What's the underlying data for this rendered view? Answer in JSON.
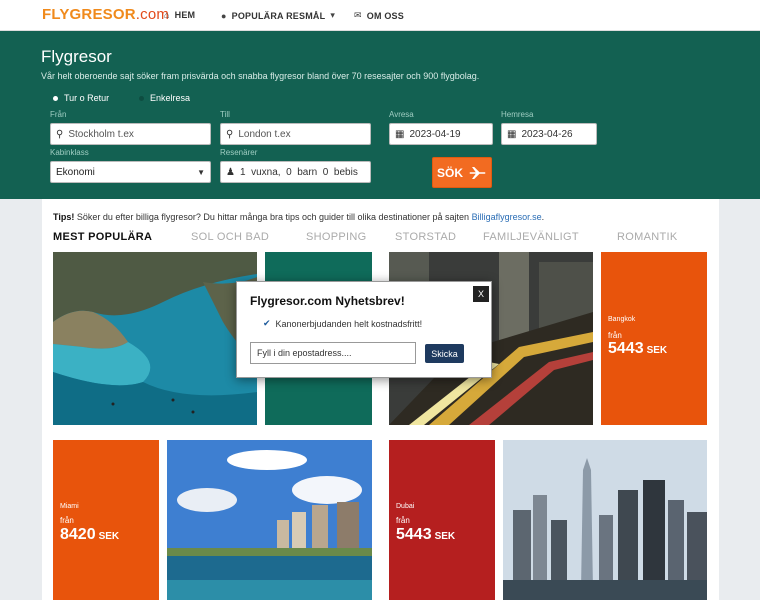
{
  "nav": {
    "logo_main": "FLYGRESOR",
    "logo_tld": ".com",
    "items": [
      {
        "label": "HEM",
        "icon": "home-icon"
      },
      {
        "label": "POPULÄRA RESMÅL",
        "icon": "map-marker-icon",
        "dropdown": "chevron-down-icon"
      },
      {
        "label": "OM OSS",
        "icon": "envelope-icon"
      }
    ]
  },
  "hero": {
    "title": "Flygresor",
    "subtitle": "Vår helt oberoende sajt söker fram prisvärda och snabba flygresor bland över 70 resesajter och 900 flygbolag.",
    "trip_types": [
      "Tur o Retur",
      "Enkelresa"
    ],
    "from": {
      "label": "Från",
      "placeholder": "Stockholm t.ex"
    },
    "to": {
      "label": "Till",
      "placeholder": "London t.ex"
    },
    "depart": {
      "label": "Avresa",
      "value": "2023-04-19"
    },
    "return": {
      "label": "Hemresa",
      "value": "2023-04-26"
    },
    "cabin": {
      "label": "Kabinklass",
      "value": "Ekonomi"
    },
    "travellers": {
      "label": "Resenärer",
      "value": "1  vuxna,  0  barn  0  bebis"
    },
    "search_label": "SÖK"
  },
  "tips": {
    "bold": "Tips!",
    "text": " Söker du efter billiga flygresor? Du hittar många bra tips och guider till olika destinationer på sajten ",
    "link": "Billigaflygresor.se",
    "tail": "."
  },
  "tabs": [
    "MEST POPULÄRA",
    "SOL OCH BAD",
    "SHOPPING",
    "STORSTAD",
    "FAMILJEVÄNLIGT",
    "ROMANTIK"
  ],
  "deals": [
    {
      "city": "Bangkok",
      "from_label": "från",
      "price": "5443",
      "currency": "SEK"
    },
    {
      "city": "Miami",
      "from_label": "från",
      "price": "8420",
      "currency": "SEK"
    },
    {
      "city": "Dubai",
      "from_label": "från",
      "price": "5443",
      "currency": "SEK"
    }
  ],
  "modal": {
    "title": "Flygresor.com Nyhetsbrev!",
    "close": "X",
    "benefit": "Kanonerbjudanden helt kostnadsfritt!",
    "email_placeholder": "Fyll i din epostadress....",
    "submit": "Skicka"
  },
  "colors": {
    "hero_bg": "#136152",
    "orange": "#f26b21",
    "tile_orange": "#e8540c",
    "tile_red": "#b51f1f",
    "tile_teal": "#0f6b5a"
  }
}
